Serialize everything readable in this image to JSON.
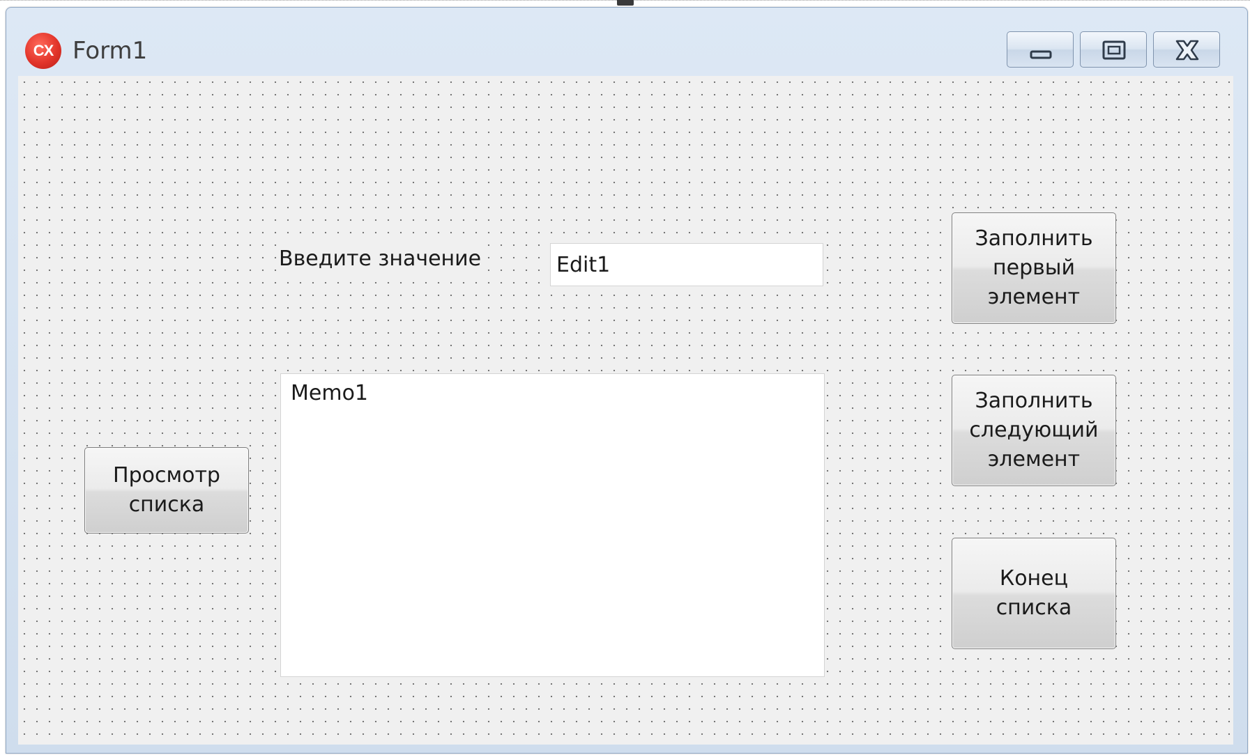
{
  "window": {
    "title": "Form1",
    "app_icon_label": "CX",
    "caption_buttons": [
      "minimize-icon",
      "maximize-icon",
      "close-icon"
    ]
  },
  "form": {
    "label_enter": "Введите значение",
    "edit1_value": "Edit1",
    "memo1_value": "Memo1",
    "buttons": {
      "view_list": "Просмотр\nсписка",
      "fill_first": "Заполнить\nпервый\nэлемент",
      "fill_next": "Заполнить\nследующий\nэлемент",
      "end_list": "Конец\nсписка"
    }
  },
  "colors": {
    "client_background": "#f0f0f0",
    "grid_dot": "#6e6e6e",
    "titlebar": "#dde8f5",
    "app_icon": "#e2342a"
  }
}
